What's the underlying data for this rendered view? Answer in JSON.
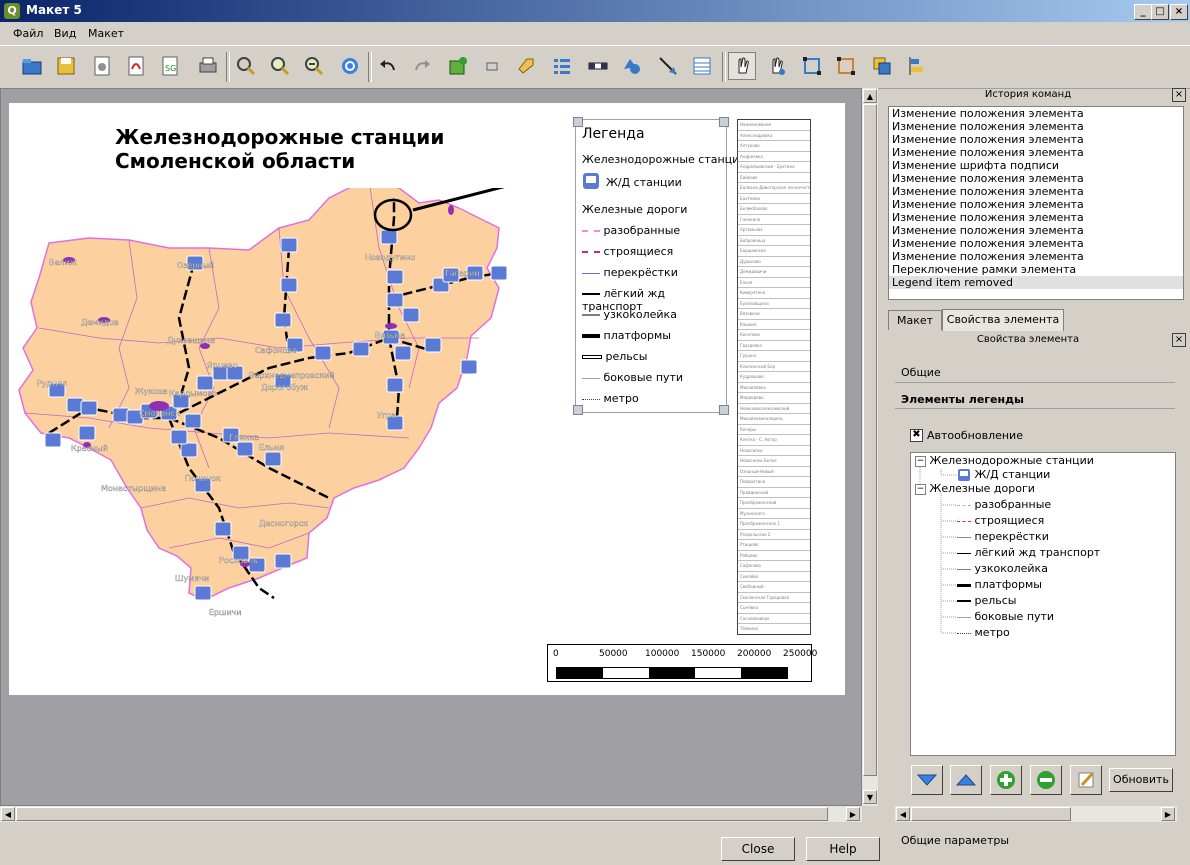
{
  "window": {
    "title": "Макет 5",
    "app_icon": "Q",
    "min": "_",
    "max": "□",
    "close": "×"
  },
  "menu": [
    "Файл",
    "Вид",
    "Макет"
  ],
  "map": {
    "title_line1": "Железнодорожные станции",
    "title_line2": "Смоленской области",
    "region_labels": [
      "Велиж",
      "Демидов",
      "Духовщина",
      "Сафоново",
      "Вязьма",
      "Новодугино",
      "Гагарин",
      "Руднял",
      "Смоленск",
      "Кардымово",
      "Ярцево",
      "Верхнеднепровский",
      "Дорогобуж",
      "Угра",
      "Красный",
      "Монастырщина",
      "Починок",
      "Ельня",
      "Десногорск",
      "Рославль",
      "Шумячи",
      "Ершичи",
      "Глинка",
      "Озёрный",
      "Жукова"
    ],
    "scale_ticks": [
      "0",
      "50000",
      "100000",
      "150000",
      "200000",
      "250000"
    ],
    "name_list": [
      "Наименование",
      "Александровка",
      "Алтухово",
      "Андреевка",
      "Андрейцевский - Бухтино",
      "Байково",
      "Балкана-Дивогорское лесничество",
      "Бахтейки",
      "Беликбахово",
      "Гнилкино",
      "Артемьево",
      "Бобровница",
      "Борщевская",
      "Дурыково",
      "Демидовичи",
      "Ельня",
      "Киверятино",
      "Бухоловщина",
      "Вязовичи",
      "Кашино",
      "Киселево",
      "Гвоздевка",
      "Грушно",
      "Ключинский Бор",
      "Кудряшово",
      "Михайловка",
      "Медведево",
      "Новоновоалексеевский",
      "Михайловоколодезь",
      "Кочеры",
      "Клетка - С. Автор",
      "Новосилки",
      "Новосилки Белое",
      "Озерный-Новый",
      "Поворотино",
      "Правдинский",
      "Преображенский",
      "Мусинского",
      "Преображенское 1",
      "Раздольское 2",
      "Ртищево",
      "Рябцево",
      "Сафоново",
      "Семлёво",
      "Свободный",
      "Смоленская Городовая",
      "Сычёвка",
      "Сосновоаверк",
      "Тёмкино",
      "Троицкое",
      "Туманово",
      "Тёмкино-Старое",
      "Угорье",
      "Фролово"
    ]
  },
  "legend": {
    "title": "Легенда",
    "group1": "Железнодорожные станции",
    "item_stations": "Ж/Д станции",
    "group2": "Железные дороги",
    "items": [
      {
        "label": "разобранные",
        "style": "dashed-pink"
      },
      {
        "label": "строящиеся",
        "style": "dashed-red"
      },
      {
        "label": "перекрёстки",
        "style": "thin-blue"
      },
      {
        "label": "лёгкий жд транспорт",
        "style": "solid-black"
      },
      {
        "label": "узкоколейка",
        "style": "gray"
      },
      {
        "label": "платформы",
        "style": "thick-black"
      },
      {
        "label": "рельсы",
        "style": "rail"
      },
      {
        "label": "боковые пути",
        "style": "light-gray"
      },
      {
        "label": "метро",
        "style": "dotted"
      }
    ]
  },
  "history": {
    "title": "История команд",
    "items": [
      "Изменение положения элемента",
      "Изменение положения элемента",
      "Изменение положения элемента",
      "Изменение положения элемента",
      "Изменение шрифта подписи",
      "Изменение положения элемента",
      "Изменение положения элемента",
      "Изменение положения элемента",
      "Изменение положения элемента",
      "Изменение положения элемента",
      "Изменение положения элемента",
      "Изменение положения элемента",
      "Переключение рамки элемента",
      "Legend item removed"
    ],
    "selected_index": 13
  },
  "tabs": [
    "Макет",
    "Свойства элемента"
  ],
  "props": {
    "title": "Свойства элемента",
    "section_general": "Общие",
    "section_legend": "Элементы легенды",
    "autoupdate": "Автообновление",
    "update_button": "Обновить",
    "footer_section": "Общие параметры"
  },
  "tree": {
    "group1": "Железнодорожные станции",
    "item_stations": "Ж/Д станции",
    "group2": "Железные дороги",
    "items": [
      "разобранные",
      "строящиеся",
      "перекрёстки",
      "лёгкий жд транспорт",
      "узкоколейка",
      "платформы",
      "рельсы",
      "боковые пути",
      "метро"
    ]
  },
  "buttons": {
    "close": "Close",
    "help": "Help"
  },
  "colors": {
    "region_fill": "#fdd0a0",
    "border_pink": "#e070e0",
    "station_blue": "#5a7ad6",
    "title_bar": "#0a246a"
  }
}
